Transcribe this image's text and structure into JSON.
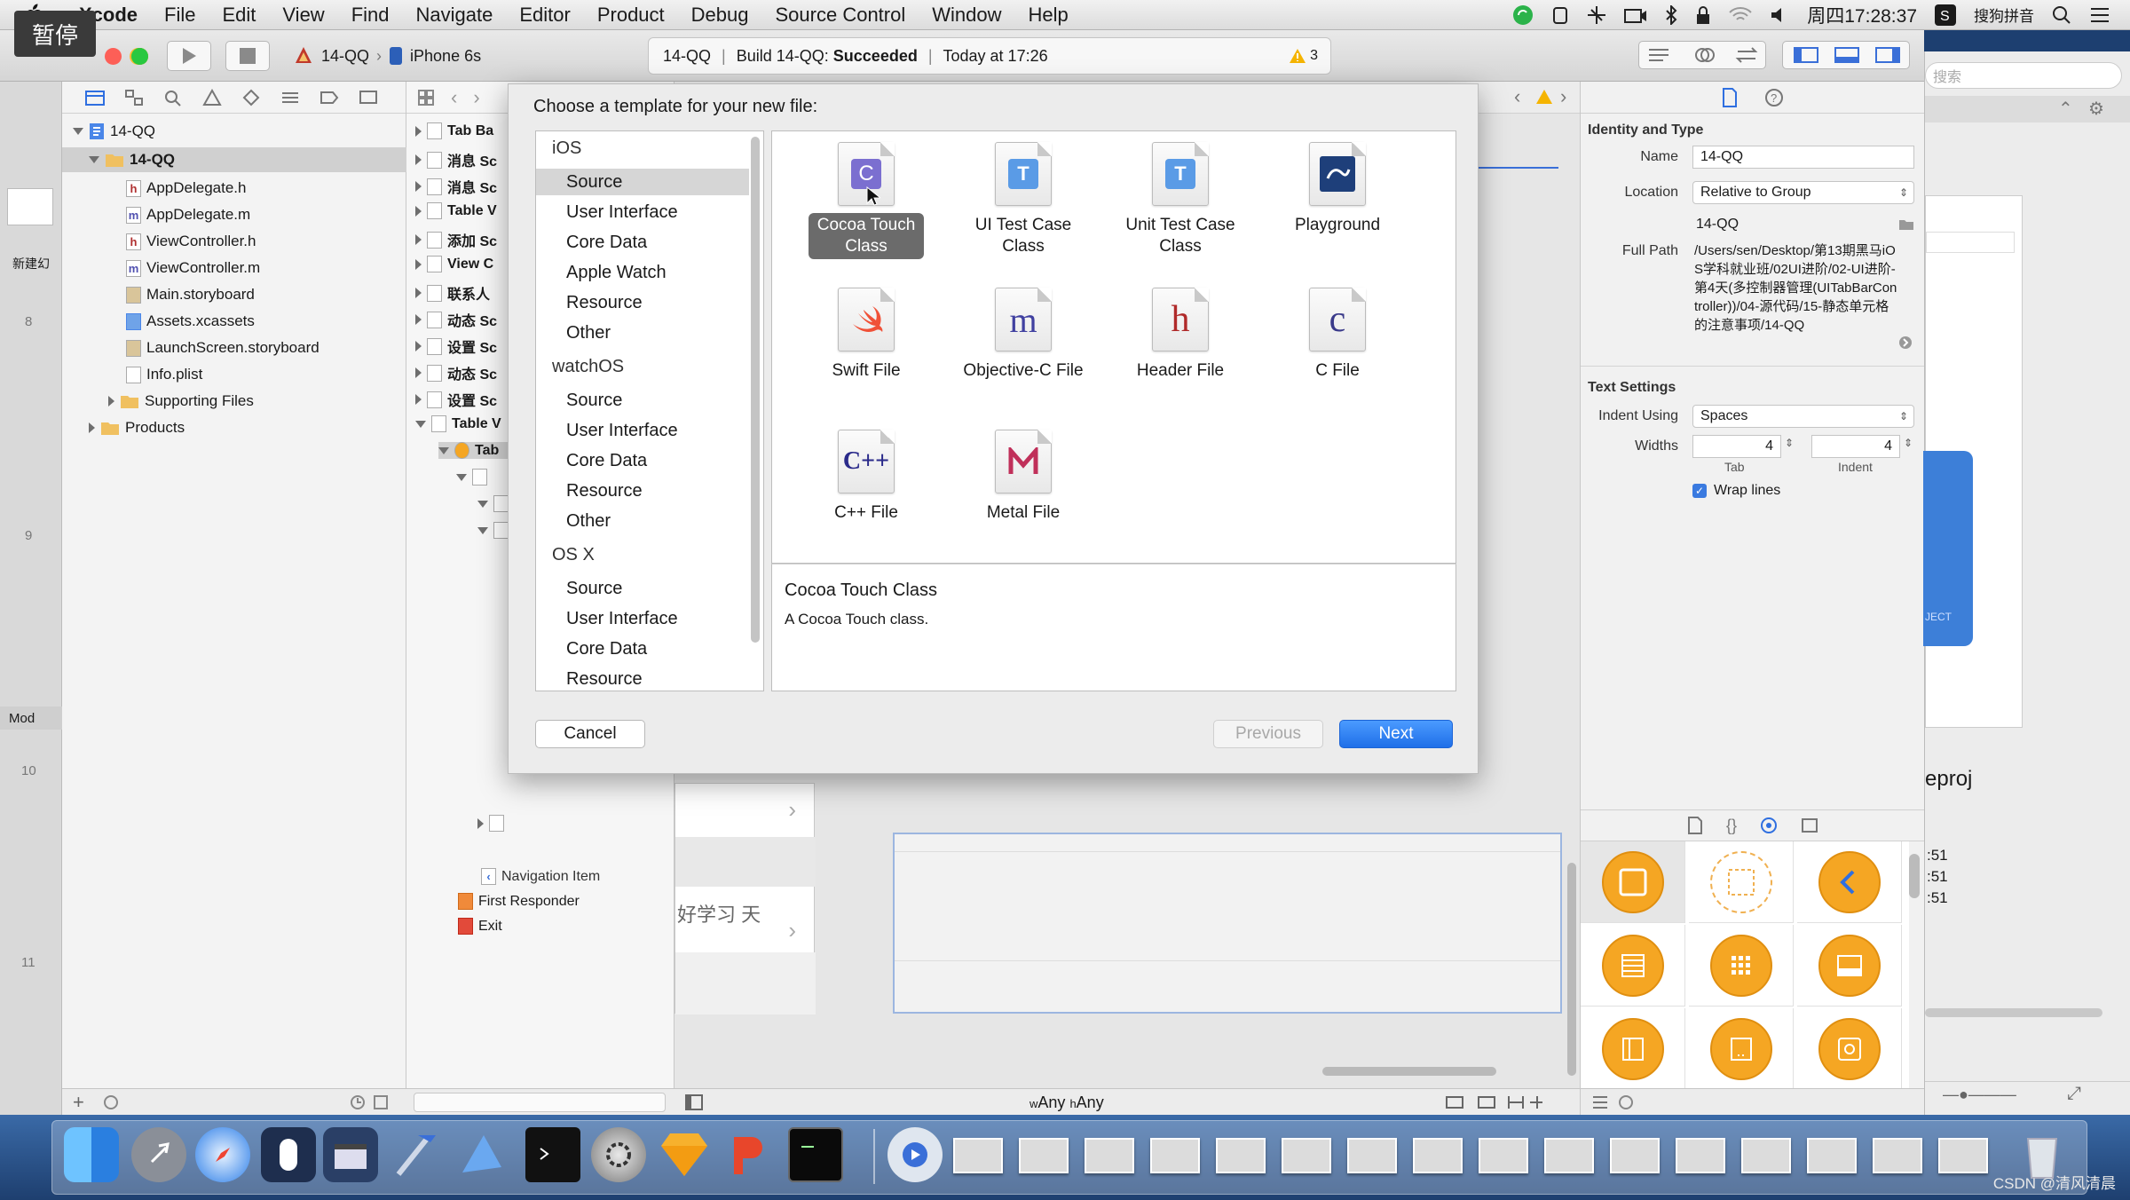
{
  "menubar": {
    "app": "Xcode",
    "items": [
      "File",
      "Edit",
      "View",
      "Find",
      "Navigate",
      "Editor",
      "Product",
      "Debug",
      "Source Control",
      "Window",
      "Help"
    ],
    "clock": "周四17:28:37",
    "input_method": "搜狗拼音"
  },
  "overlay": {
    "pause_label": "暂停"
  },
  "toolbar": {
    "scheme": "14-QQ",
    "device": "iPhone 6s",
    "activity_project": "14-QQ",
    "activity_build": "Build 14-QQ:",
    "activity_status": "Succeeded",
    "activity_time": "Today at 17:26",
    "warning_count": "3"
  },
  "navigator": {
    "project": "14-QQ",
    "group": "14-QQ",
    "files": [
      {
        "name": "AppDelegate.h",
        "icon": "h"
      },
      {
        "name": "AppDelegate.m",
        "icon": "m"
      },
      {
        "name": "ViewController.h",
        "icon": "h"
      },
      {
        "name": "ViewController.m",
        "icon": "m"
      },
      {
        "name": "Main.storyboard",
        "icon": "storyboard"
      },
      {
        "name": "Assets.xcassets",
        "icon": "assets"
      },
      {
        "name": "LaunchScreen.storyboard",
        "icon": "storyboard"
      },
      {
        "name": "Info.plist",
        "icon": "plist"
      }
    ],
    "supporting": "Supporting Files",
    "products": "Products"
  },
  "left_strip": {
    "label_top": "新建幻",
    "label_mod": "Mod",
    "numbers": [
      "8",
      "9",
      "10",
      "11"
    ]
  },
  "outline": {
    "rows": [
      "Tab Ba",
      "消息 Sc",
      "消息 Sc",
      "Table V",
      "添加 Sc",
      "View C",
      "联系人",
      "动态 Sc",
      "设置 Sc",
      "动态 Sc",
      "设置 Sc",
      "Table V",
      "Tab"
    ],
    "navigation_item": "Navigation Item",
    "first_responder": "First Responder",
    "exit": "Exit"
  },
  "canvas": {
    "chinese_cell": "好学习 天",
    "size_w": "Any",
    "size_h": "Any"
  },
  "dialog": {
    "title": "Choose a template for your new file:",
    "categories": [
      {
        "label": "iOS",
        "level": 0
      },
      {
        "label": "Source",
        "level": 1,
        "selected": true
      },
      {
        "label": "User Interface",
        "level": 1
      },
      {
        "label": "Core Data",
        "level": 1
      },
      {
        "label": "Apple Watch",
        "level": 1
      },
      {
        "label": "Resource",
        "level": 1
      },
      {
        "label": "Other",
        "level": 1
      },
      {
        "label": "watchOS",
        "level": 0
      },
      {
        "label": "Source",
        "level": 1
      },
      {
        "label": "User Interface",
        "level": 1
      },
      {
        "label": "Core Data",
        "level": 1
      },
      {
        "label": "Resource",
        "level": 1
      },
      {
        "label": "Other",
        "level": 1
      },
      {
        "label": "OS X",
        "level": 0
      },
      {
        "label": "Source",
        "level": 1
      },
      {
        "label": "User Interface",
        "level": 1
      },
      {
        "label": "Core Data",
        "level": 1
      },
      {
        "label": "Resource",
        "level": 1
      }
    ],
    "templates": [
      {
        "line1": "Cocoa Touch",
        "line2": "Class",
        "glyph": "C",
        "selected": true
      },
      {
        "line1": "UI Test Case",
        "line2": "Class",
        "glyph": "T"
      },
      {
        "line1": "Unit Test Case",
        "line2": "Class",
        "glyph": "T"
      },
      {
        "line1": "Playground",
        "line2": "",
        "glyph": "playground"
      },
      {
        "line1": "Swift File",
        "line2": "",
        "glyph": "swift"
      },
      {
        "line1": "Objective-C File",
        "line2": "",
        "glyph": "m"
      },
      {
        "line1": "Header File",
        "line2": "",
        "glyph": "h"
      },
      {
        "line1": "C File",
        "line2": "",
        "glyph": "c"
      },
      {
        "line1": "C++ File",
        "line2": "",
        "glyph": "C++"
      },
      {
        "line1": "Metal File",
        "line2": "",
        "glyph": "M"
      }
    ],
    "description_title": "Cocoa Touch Class",
    "description_text": "A Cocoa Touch class.",
    "cancel": "Cancel",
    "previous": "Previous",
    "next": "Next"
  },
  "inspector": {
    "identity_header": "Identity and Type",
    "name_label": "Name",
    "name_value": "14-QQ",
    "location_label": "Location",
    "location_value": "Relative to Group",
    "location_sub": "14-QQ",
    "fullpath_label": "Full Path",
    "fullpath_value": "/Users/sen/Desktop/第13期黑马iOS学科就业班/02UI进阶/02-UI进阶-第4天(多控制器管理(UITabBarController))/04-源代码/15-静态单元格的注意事项/14-QQ",
    "text_header": "Text Settings",
    "indent_label": "Indent Using",
    "indent_value": "Spaces",
    "widths_label": "Widths",
    "tab_value": "4",
    "indent_width_value": "4",
    "tab_caption": "Tab",
    "indent_caption": "Indent",
    "wrap_label": "Wrap lines",
    "search_placeholder": "搜索",
    "eproj": "eproj",
    "times": [
      ":51",
      ":51",
      ":51"
    ]
  },
  "watermark": "CSDN @清风清晨",
  "colors": {
    "accent": "#3b82f6",
    "folder": "#f0c060",
    "library_orange": "#f5a623"
  }
}
